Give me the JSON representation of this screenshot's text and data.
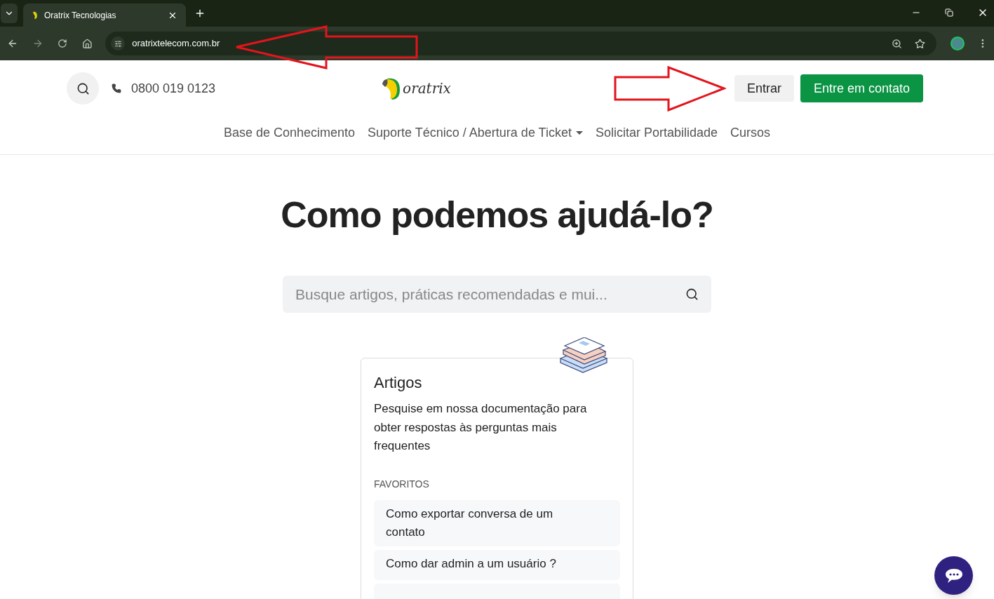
{
  "browser": {
    "tab_title": "Oratrix Tecnologias",
    "url": "oratrixtelecom.com.br"
  },
  "header": {
    "phone": "0800 019 0123",
    "logo_text": "oratrix",
    "login_button": "Entrar",
    "contact_button": "Entre em contato"
  },
  "nav": [
    {
      "label": "Base de Conhecimento",
      "dropdown": false
    },
    {
      "label": "Suporte Técnico / Abertura de Ticket",
      "dropdown": true
    },
    {
      "label": "Solicitar Portabilidade",
      "dropdown": false
    },
    {
      "label": "Cursos",
      "dropdown": false
    }
  ],
  "hero": {
    "title": "Como podemos ajudá-lo?",
    "search_placeholder": "Busque artigos, práticas recomendadas e mui..."
  },
  "card": {
    "title": "Artigos",
    "description": "Pesquise em nossa documentação para obter respostas às perguntas mais frequentes",
    "section_label": "FAVORITOS",
    "favorites": [
      {
        "kind": "article",
        "label": "Como exportar conversa de um contato"
      },
      {
        "kind": "article",
        "label": "Como dar admin a um usuário ?"
      },
      {
        "kind": "cut_off"
      }
    ]
  }
}
